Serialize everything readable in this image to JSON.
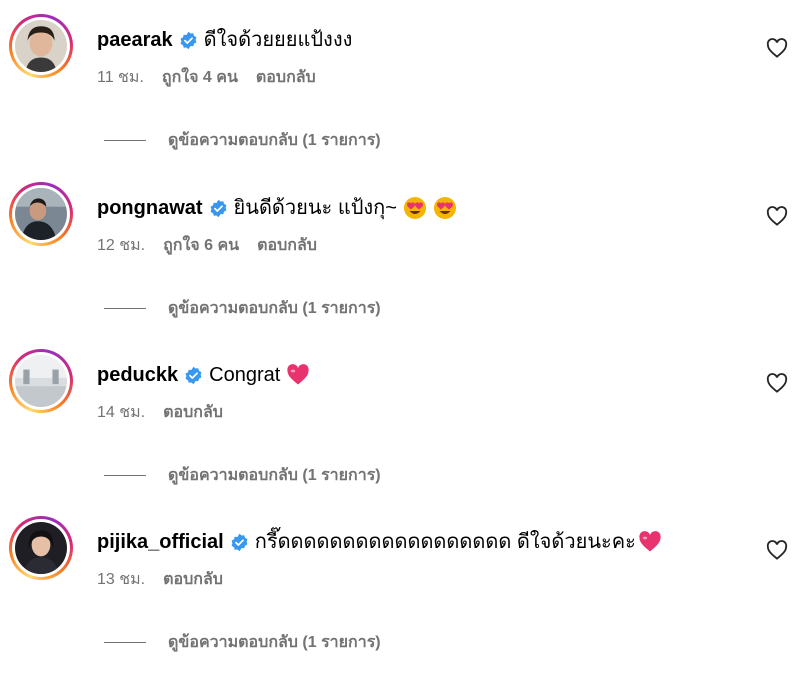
{
  "comments": [
    {
      "username": "paearak",
      "text": "ดีใจด้วยยยแป้งงง",
      "time": "11 ชม.",
      "likes": "ถูกใจ 4 คน",
      "reply": "ตอบกลับ",
      "view_replies": "ดูข้อความตอบกลับ (1 รายการ)"
    },
    {
      "username": "pongnawat",
      "text": "ยินดีด้วยนะ แป้งกุ~",
      "emojis": [
        "heart-eyes-emoji",
        "heart-eyes-emoji"
      ],
      "time": "12 ชม.",
      "likes": "ถูกใจ 6 คน",
      "reply": "ตอบกลับ",
      "view_replies": "ดูข้อความตอบกลับ (1 รายการ)"
    },
    {
      "username": "peduckk",
      "text": "Congrat",
      "emojis": [
        "pink-heart-emoji"
      ],
      "time": "14 ชม.",
      "reply": "ตอบกลับ",
      "view_replies": "ดูข้อความตอบกลับ (1 รายการ)"
    },
    {
      "username": "pijika_official",
      "text": "กรี๊ดดดดดดดดดดดดดดดดดด ดีใจด้วยนะคะ",
      "emojis": [
        "pink-heart-emoji"
      ],
      "time": "13 ชม.",
      "reply": "ตอบกลับ",
      "view_replies": "ดูข้อความตอบกลับ (1 รายการ)"
    }
  ],
  "colors": {
    "verified_badge": "#3897f0",
    "secondary_text": "#737373",
    "emoji_pink": "#e8336f",
    "emoji_face": "#f5b400"
  },
  "icons": {
    "verified": "verified-badge-icon",
    "like": "heart-outline-icon"
  }
}
